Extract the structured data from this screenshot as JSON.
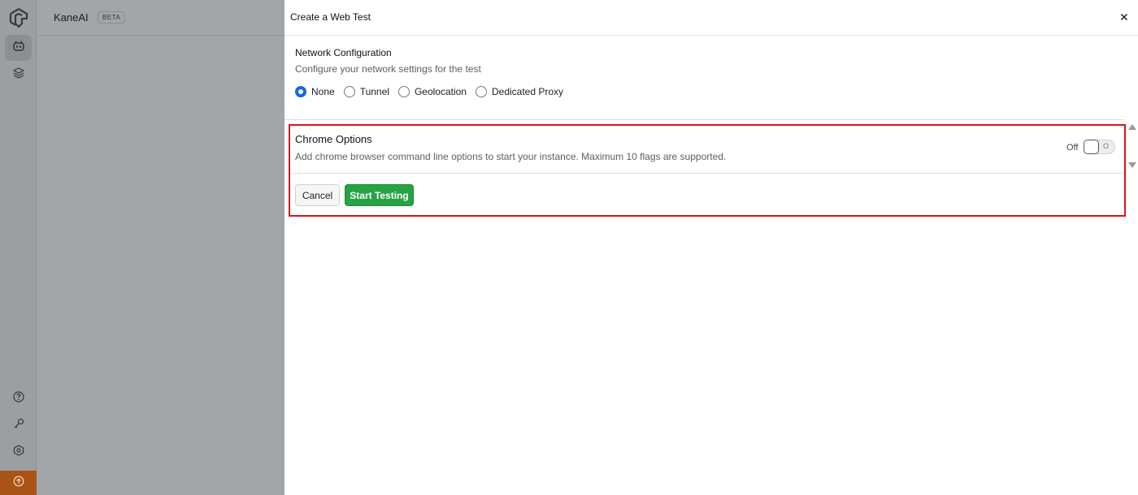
{
  "app": {
    "brand": "KaneAI",
    "badge": "BETA"
  },
  "sidebar": {
    "top_items": [
      {
        "icon": "bot-icon",
        "active": true
      },
      {
        "icon": "layers-icon",
        "active": false
      }
    ],
    "bottom_items": [
      {
        "icon": "help-icon"
      },
      {
        "icon": "key-icon"
      },
      {
        "icon": "settings-icon"
      },
      {
        "icon": "upgrade-icon"
      }
    ],
    "bottom_accent_color": "#a95416"
  },
  "drawer": {
    "title": "Create a Web Test",
    "close_icon": "close-icon"
  },
  "network": {
    "title": "Network Configuration",
    "subtitle": "Configure your network settings for the test",
    "options": [
      {
        "label": "None",
        "checked": true
      },
      {
        "label": "Tunnel",
        "checked": false
      },
      {
        "label": "Geolocation",
        "checked": false
      },
      {
        "label": "Dedicated Proxy",
        "checked": false
      }
    ],
    "selected_color": "#1a66e0"
  },
  "chrome_options": {
    "title": "Chrome Options",
    "description": "Add chrome browser command line options to start your instance. Maximum 10 flags are supported.",
    "toggle_label": "Off",
    "toggle_state": false,
    "highlight_color": "#d9141c"
  },
  "actions": {
    "cancel_label": "Cancel",
    "start_label": "Start Testing",
    "start_color": "#26a345"
  }
}
